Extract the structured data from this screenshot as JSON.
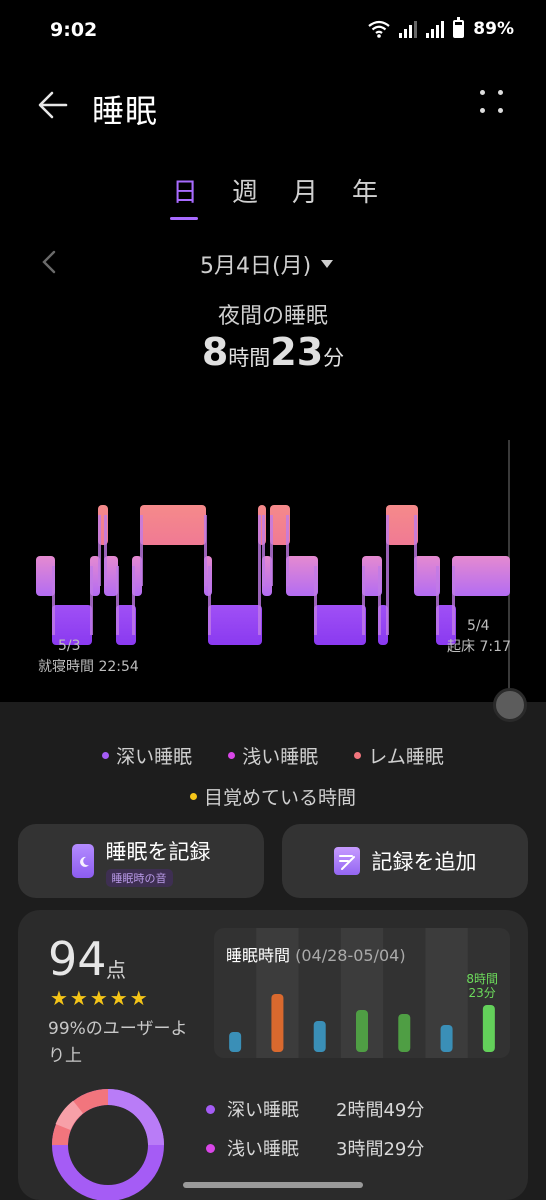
{
  "status": {
    "time": "9:02",
    "battery": "89%"
  },
  "header": {
    "title": "睡眠"
  },
  "tabs": [
    "日",
    "週",
    "月",
    "年"
  ],
  "date": {
    "label": "5月4日(月)"
  },
  "summary": {
    "label": "夜間の睡眠",
    "hours": "8",
    "hours_unit": "時間",
    "minutes": "23",
    "minutes_unit": "分"
  },
  "chart_data": {
    "type": "hypnogram",
    "start": {
      "date": "5/3",
      "label": "就寝時間 22:54"
    },
    "end": {
      "date": "5/4",
      "label": "起床 7:17"
    },
    "stages": [
      "深い睡眠",
      "浅い睡眠",
      "レム睡眠",
      "目覚めている時間"
    ],
    "colors": {
      "deep": "#9b46f5",
      "light": "#d98cf0",
      "rem": "#f27e85",
      "awake": "#f5c518"
    }
  },
  "legend": [
    {
      "label": "深い睡眠",
      "color": "#a55cf5"
    },
    {
      "label": "浅い睡眠",
      "color": "#d946e8"
    },
    {
      "label": "レム睡眠",
      "color": "#f2757d"
    },
    {
      "label": "目覚めている時間",
      "color": "#f5c518"
    }
  ],
  "actions": {
    "record": {
      "label": "睡眠を記録",
      "sub": "睡眠時の音"
    },
    "add": {
      "label": "記録を追加"
    }
  },
  "score": {
    "value": "94",
    "unit": "点",
    "stars": "★★★★★",
    "desc": "99%のユーザーより上",
    "weekly": {
      "title": "睡眠時間",
      "range": "(04/28-05/04)",
      "last_label_1": "8時間",
      "last_label_2": "23分"
    },
    "stages": [
      {
        "name": "深い睡眠",
        "value": "2時間49分",
        "color": "#a55cf5"
      },
      {
        "name": "浅い睡眠",
        "value": "3時間29分",
        "color": "#d946e8"
      }
    ]
  }
}
